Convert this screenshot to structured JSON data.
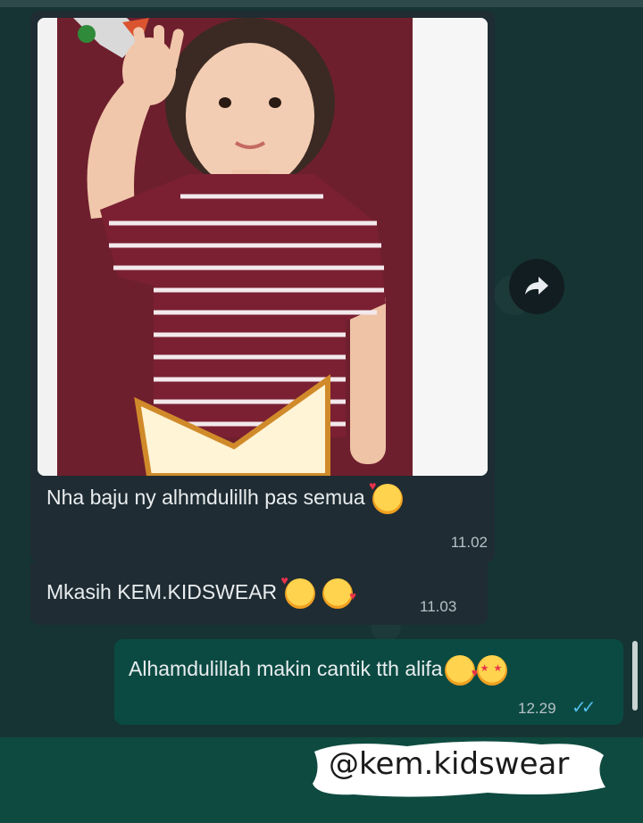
{
  "messages": [
    {
      "type": "photo",
      "caption": "Nha baju ny alhmdulillh pas semua",
      "emoji": [
        "smiling-face-with-hearts"
      ],
      "time": "11.02",
      "direction": "incoming"
    },
    {
      "type": "text",
      "text": "Mkasih KEM.KIDSWEAR",
      "emoji": [
        "smiling-face-with-hearts",
        "face-blowing-kiss"
      ],
      "time": "11.03",
      "direction": "incoming"
    },
    {
      "type": "text",
      "text": "Alhamdulillah makin cantik tth alifa",
      "emoji": [
        "face-blowing-kiss",
        "star-struck"
      ],
      "time": "12.29",
      "status": "read",
      "direction": "outgoing"
    }
  ],
  "icons": {
    "forward": "forward-icon",
    "read_receipt": "double-check-icon"
  },
  "watermark": "@kem.kidswear",
  "colors": {
    "incoming_bubble": "#1f2c33",
    "outgoing_bubble": "#0b4a42",
    "read_tick": "#53bdeb",
    "footer": "#0e4a3f"
  }
}
